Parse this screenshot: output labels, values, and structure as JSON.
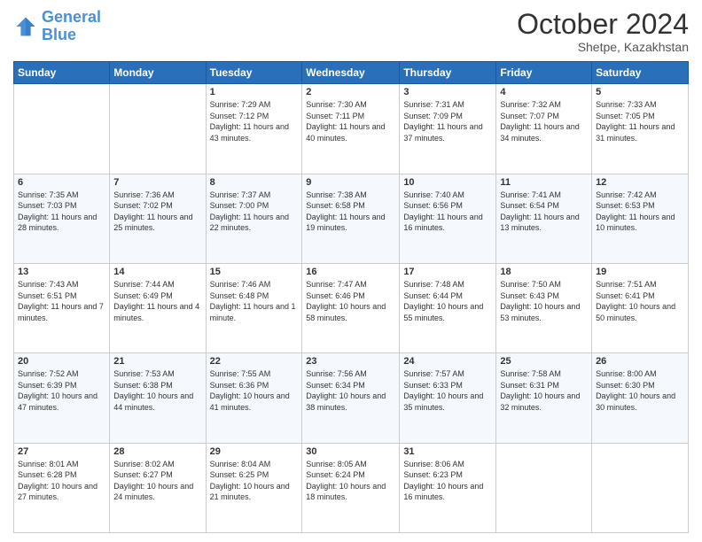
{
  "header": {
    "logo_line1": "General",
    "logo_line2": "Blue",
    "month": "October 2024",
    "location": "Shetpe, Kazakhstan"
  },
  "days_of_week": [
    "Sunday",
    "Monday",
    "Tuesday",
    "Wednesday",
    "Thursday",
    "Friday",
    "Saturday"
  ],
  "weeks": [
    [
      {
        "day": "",
        "sunrise": "",
        "sunset": "",
        "daylight": ""
      },
      {
        "day": "",
        "sunrise": "",
        "sunset": "",
        "daylight": ""
      },
      {
        "day": "1",
        "sunrise": "Sunrise: 7:29 AM",
        "sunset": "Sunset: 7:12 PM",
        "daylight": "Daylight: 11 hours and 43 minutes."
      },
      {
        "day": "2",
        "sunrise": "Sunrise: 7:30 AM",
        "sunset": "Sunset: 7:11 PM",
        "daylight": "Daylight: 11 hours and 40 minutes."
      },
      {
        "day": "3",
        "sunrise": "Sunrise: 7:31 AM",
        "sunset": "Sunset: 7:09 PM",
        "daylight": "Daylight: 11 hours and 37 minutes."
      },
      {
        "day": "4",
        "sunrise": "Sunrise: 7:32 AM",
        "sunset": "Sunset: 7:07 PM",
        "daylight": "Daylight: 11 hours and 34 minutes."
      },
      {
        "day": "5",
        "sunrise": "Sunrise: 7:33 AM",
        "sunset": "Sunset: 7:05 PM",
        "daylight": "Daylight: 11 hours and 31 minutes."
      }
    ],
    [
      {
        "day": "6",
        "sunrise": "Sunrise: 7:35 AM",
        "sunset": "Sunset: 7:03 PM",
        "daylight": "Daylight: 11 hours and 28 minutes."
      },
      {
        "day": "7",
        "sunrise": "Sunrise: 7:36 AM",
        "sunset": "Sunset: 7:02 PM",
        "daylight": "Daylight: 11 hours and 25 minutes."
      },
      {
        "day": "8",
        "sunrise": "Sunrise: 7:37 AM",
        "sunset": "Sunset: 7:00 PM",
        "daylight": "Daylight: 11 hours and 22 minutes."
      },
      {
        "day": "9",
        "sunrise": "Sunrise: 7:38 AM",
        "sunset": "Sunset: 6:58 PM",
        "daylight": "Daylight: 11 hours and 19 minutes."
      },
      {
        "day": "10",
        "sunrise": "Sunrise: 7:40 AM",
        "sunset": "Sunset: 6:56 PM",
        "daylight": "Daylight: 11 hours and 16 minutes."
      },
      {
        "day": "11",
        "sunrise": "Sunrise: 7:41 AM",
        "sunset": "Sunset: 6:54 PM",
        "daylight": "Daylight: 11 hours and 13 minutes."
      },
      {
        "day": "12",
        "sunrise": "Sunrise: 7:42 AM",
        "sunset": "Sunset: 6:53 PM",
        "daylight": "Daylight: 11 hours and 10 minutes."
      }
    ],
    [
      {
        "day": "13",
        "sunrise": "Sunrise: 7:43 AM",
        "sunset": "Sunset: 6:51 PM",
        "daylight": "Daylight: 11 hours and 7 minutes."
      },
      {
        "day": "14",
        "sunrise": "Sunrise: 7:44 AM",
        "sunset": "Sunset: 6:49 PM",
        "daylight": "Daylight: 11 hours and 4 minutes."
      },
      {
        "day": "15",
        "sunrise": "Sunrise: 7:46 AM",
        "sunset": "Sunset: 6:48 PM",
        "daylight": "Daylight: 11 hours and 1 minute."
      },
      {
        "day": "16",
        "sunrise": "Sunrise: 7:47 AM",
        "sunset": "Sunset: 6:46 PM",
        "daylight": "Daylight: 10 hours and 58 minutes."
      },
      {
        "day": "17",
        "sunrise": "Sunrise: 7:48 AM",
        "sunset": "Sunset: 6:44 PM",
        "daylight": "Daylight: 10 hours and 55 minutes."
      },
      {
        "day": "18",
        "sunrise": "Sunrise: 7:50 AM",
        "sunset": "Sunset: 6:43 PM",
        "daylight": "Daylight: 10 hours and 53 minutes."
      },
      {
        "day": "19",
        "sunrise": "Sunrise: 7:51 AM",
        "sunset": "Sunset: 6:41 PM",
        "daylight": "Daylight: 10 hours and 50 minutes."
      }
    ],
    [
      {
        "day": "20",
        "sunrise": "Sunrise: 7:52 AM",
        "sunset": "Sunset: 6:39 PM",
        "daylight": "Daylight: 10 hours and 47 minutes."
      },
      {
        "day": "21",
        "sunrise": "Sunrise: 7:53 AM",
        "sunset": "Sunset: 6:38 PM",
        "daylight": "Daylight: 10 hours and 44 minutes."
      },
      {
        "day": "22",
        "sunrise": "Sunrise: 7:55 AM",
        "sunset": "Sunset: 6:36 PM",
        "daylight": "Daylight: 10 hours and 41 minutes."
      },
      {
        "day": "23",
        "sunrise": "Sunrise: 7:56 AM",
        "sunset": "Sunset: 6:34 PM",
        "daylight": "Daylight: 10 hours and 38 minutes."
      },
      {
        "day": "24",
        "sunrise": "Sunrise: 7:57 AM",
        "sunset": "Sunset: 6:33 PM",
        "daylight": "Daylight: 10 hours and 35 minutes."
      },
      {
        "day": "25",
        "sunrise": "Sunrise: 7:58 AM",
        "sunset": "Sunset: 6:31 PM",
        "daylight": "Daylight: 10 hours and 32 minutes."
      },
      {
        "day": "26",
        "sunrise": "Sunrise: 8:00 AM",
        "sunset": "Sunset: 6:30 PM",
        "daylight": "Daylight: 10 hours and 30 minutes."
      }
    ],
    [
      {
        "day": "27",
        "sunrise": "Sunrise: 8:01 AM",
        "sunset": "Sunset: 6:28 PM",
        "daylight": "Daylight: 10 hours and 27 minutes."
      },
      {
        "day": "28",
        "sunrise": "Sunrise: 8:02 AM",
        "sunset": "Sunset: 6:27 PM",
        "daylight": "Daylight: 10 hours and 24 minutes."
      },
      {
        "day": "29",
        "sunrise": "Sunrise: 8:04 AM",
        "sunset": "Sunset: 6:25 PM",
        "daylight": "Daylight: 10 hours and 21 minutes."
      },
      {
        "day": "30",
        "sunrise": "Sunrise: 8:05 AM",
        "sunset": "Sunset: 6:24 PM",
        "daylight": "Daylight: 10 hours and 18 minutes."
      },
      {
        "day": "31",
        "sunrise": "Sunrise: 8:06 AM",
        "sunset": "Sunset: 6:23 PM",
        "daylight": "Daylight: 10 hours and 16 minutes."
      },
      {
        "day": "",
        "sunrise": "",
        "sunset": "",
        "daylight": ""
      },
      {
        "day": "",
        "sunrise": "",
        "sunset": "",
        "daylight": ""
      }
    ]
  ]
}
